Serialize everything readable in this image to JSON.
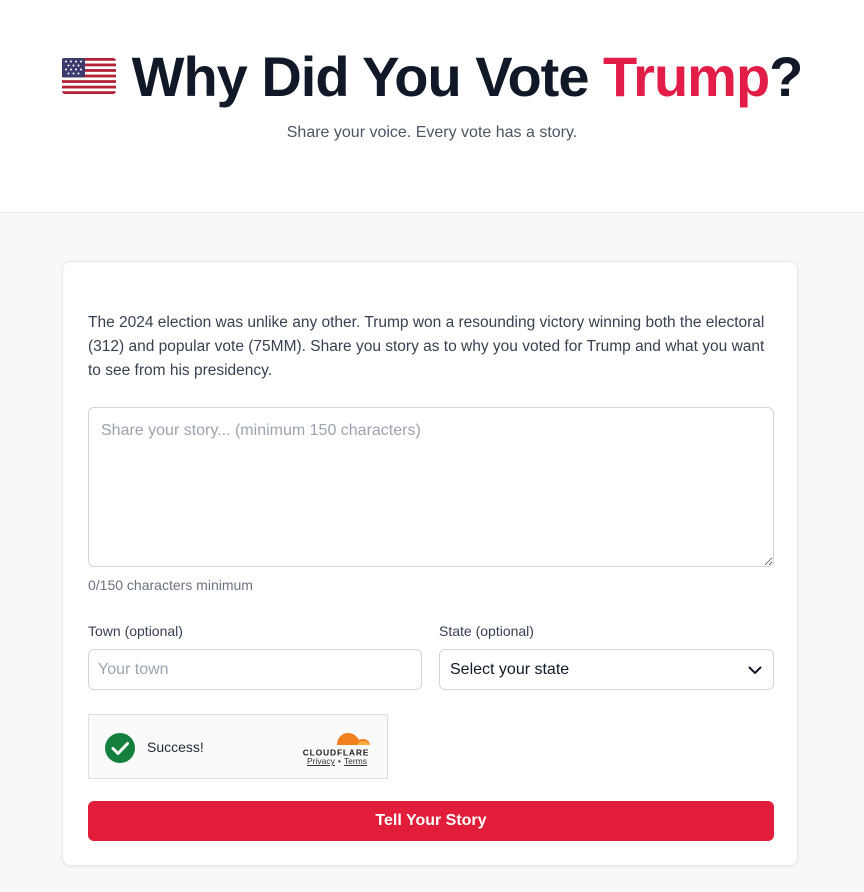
{
  "header": {
    "flag_icon": "us-flag-icon",
    "title_prefix": "Why Did You Vote ",
    "title_accent": "Trump",
    "title_suffix": "?",
    "subtitle": "Share your voice. Every vote has a story."
  },
  "form": {
    "intro": "The 2024 election was unlike any other. Trump won a resounding victory winning both the electoral (312) and popular vote (75MM). Share you story as to why you voted for Trump and what you want to see from his presidency.",
    "story_placeholder": "Share your story... (minimum 150 characters)",
    "story_value": "",
    "char_counter": "0/150 characters minimum",
    "town_label": "Town (optional)",
    "town_placeholder": "Your town",
    "town_value": "",
    "state_label": "State (optional)",
    "state_selected": "Select your state",
    "captcha": {
      "status": "Success!",
      "provider": "CLOUDFLARE",
      "privacy": "Privacy",
      "separator": "•",
      "terms": "Terms"
    },
    "submit_label": "Tell Your Story"
  },
  "colors": {
    "accent": "#e11d48",
    "button": "#e11d39",
    "success": "#15803d",
    "cloudflare_orange": "#f38020"
  }
}
